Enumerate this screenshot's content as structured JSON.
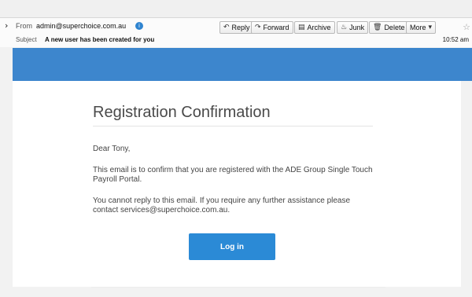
{
  "header": {
    "from_label": "From",
    "from_value": "admin@superchoice.com.au",
    "subject_label": "Subject",
    "subject_value": "A new user has been created for you",
    "time": "10:52 am"
  },
  "toolbar": {
    "reply": "Reply",
    "forward": "Forward",
    "archive": "Archive",
    "junk": "Junk",
    "delete": "Delete",
    "more": "More"
  },
  "icons": {
    "expand": "chevron-right-icon",
    "contact": "contact-icon",
    "reply": "reply-icon",
    "forward": "forward-icon",
    "archive": "archive-icon",
    "junk": "junk-icon",
    "delete": "trash-icon",
    "more": "chevron-down-icon",
    "star": "star-icon"
  },
  "colors": {
    "banner": "#3d86cd",
    "button": "#2b8ad6"
  },
  "email": {
    "title": "Registration Confirmation",
    "greeting": "Dear Tony,",
    "para1": "This email is to confirm that you are registered with the ADE Group Single Touch Payroll Portal.",
    "para2": "You cannot reply to this email. If you require any further assistance please contact services@superchoice.com.au.",
    "button_label": "Log in"
  }
}
